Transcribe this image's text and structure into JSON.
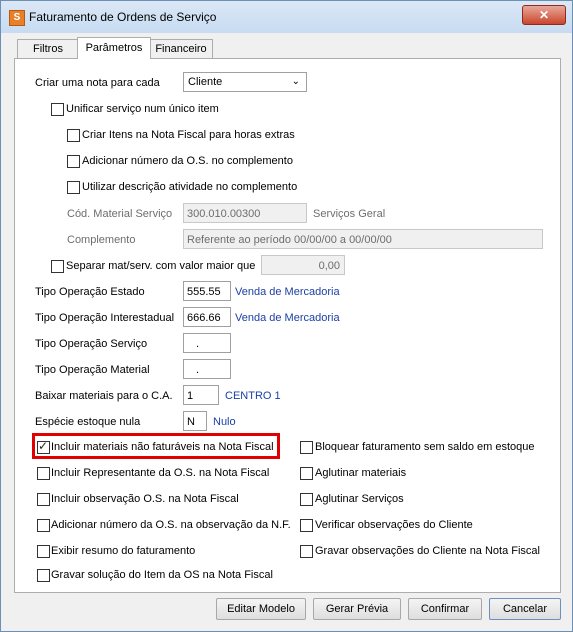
{
  "window": {
    "title": "Faturamento de Ordens de Serviço",
    "close_icon": "close-icon"
  },
  "tabs": [
    {
      "label": "Filtros"
    },
    {
      "label": "Parâmetros",
      "active": true
    },
    {
      "label": "Financeiro"
    }
  ],
  "params": {
    "nota_label": "Criar uma nota para cada",
    "nota_value": "Cliente",
    "unificar": {
      "label": "Unificar serviço num único item",
      "checked": false
    },
    "horas_extras": {
      "label": "Criar Itens na Nota Fiscal para horas extras",
      "checked": false
    },
    "numero_os": {
      "label": "Adicionar número da O.S. no complemento",
      "checked": false
    },
    "descricao_atividade": {
      "label": "Utilizar descrição atividade no complemento",
      "checked": false
    },
    "cod_material_label": "Cód. Material Serviço",
    "cod_material_value": "300.010.00300",
    "cod_material_desc": "Serviços Geral",
    "complemento_label": "Complemento",
    "complemento_value": "Referente ao período 00/00/00 a 00/00/00",
    "separar": {
      "label": "Separar mat/serv. com valor maior que",
      "checked": false
    },
    "separar_value": "0,00",
    "op_estado_label": "Tipo Operação Estado",
    "op_estado_value": "555.55",
    "op_estado_desc": "Venda de Mercadoria",
    "op_inter_label": "Tipo Operação Interestadual",
    "op_inter_value": "666.66",
    "op_inter_desc": "Venda de Mercadoria",
    "op_servico_label": "Tipo Operação Serviço",
    "op_servico_value": ".",
    "op_material_label": "Tipo Operação Material",
    "op_material_value": ".",
    "baixar_label": "Baixar materiais para o C.A.",
    "baixar_value": "1",
    "baixar_desc": "CENTRO 1",
    "especie_label": "Espécie estoque nula",
    "especie_value": "N",
    "especie_desc": "Nulo"
  },
  "checks_left": [
    {
      "label": "Incluir materiais não faturáveis na Nota Fiscal",
      "checked": true
    },
    {
      "label": "Incluir Representante da O.S. na Nota Fiscal",
      "checked": false
    },
    {
      "label": "Incluir observação O.S. na Nota Fiscal",
      "checked": false
    },
    {
      "label": "Adicionar número da O.S. na observação da N.F.",
      "checked": false
    },
    {
      "label": "Exibir resumo do faturamento",
      "checked": false
    },
    {
      "label": "Gravar solução do Item da OS na Nota Fiscal",
      "checked": false
    }
  ],
  "checks_right": [
    {
      "label": "Bloquear faturamento sem saldo em estoque",
      "checked": false
    },
    {
      "label": "Aglutinar materiais",
      "checked": false
    },
    {
      "label": "Aglutinar Serviços",
      "checked": false
    },
    {
      "label": "Verificar observações do Cliente",
      "checked": false
    },
    {
      "label": "Gravar observações do Cliente na Nota Fiscal",
      "checked": false
    }
  ],
  "buttons": {
    "editar": "Editar Modelo",
    "gerar": "Gerar Prévia",
    "confirmar": "Confirmar",
    "cancelar": "Cancelar"
  }
}
